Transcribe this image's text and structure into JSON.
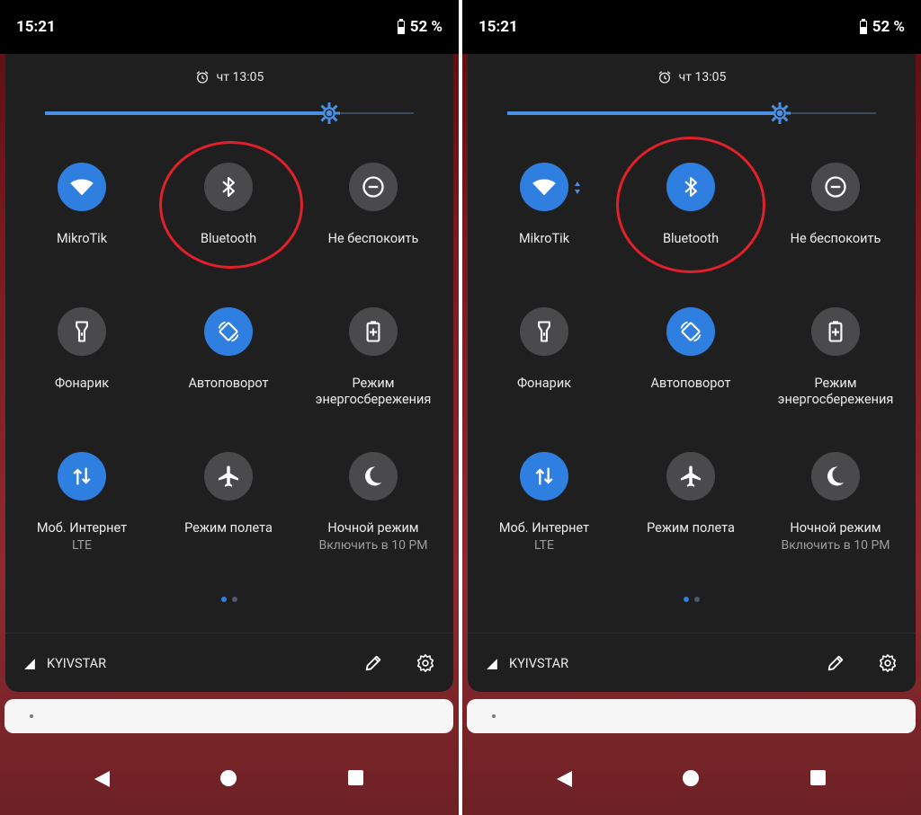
{
  "screens": [
    {
      "status": {
        "time": "15:21",
        "battery": "52 %"
      },
      "alarm": {
        "text": "чт 13:05"
      },
      "brightness": {
        "level": 0.77
      },
      "tiles": [
        {
          "label": "MikroTik",
          "sub": "",
          "state": "on",
          "icon": "wifi-icon"
        },
        {
          "label": "Bluetooth",
          "sub": "",
          "state": "off",
          "icon": "bluetooth-icon"
        },
        {
          "label": "Не беспокоить",
          "sub": "",
          "state": "off",
          "icon": "do-not-disturb-icon"
        },
        {
          "label": "Фонарик",
          "sub": "",
          "state": "off",
          "icon": "flashlight-icon"
        },
        {
          "label": "Автоповорот",
          "sub": "",
          "state": "on",
          "icon": "auto-rotate-icon"
        },
        {
          "label": "Режим энергосбережения",
          "sub": "",
          "state": "off",
          "icon": "battery-saver-icon"
        },
        {
          "label": "Моб. Интернет",
          "sub": "LTE",
          "state": "on",
          "icon": "mobile-data-icon"
        },
        {
          "label": "Режим полета",
          "sub": "",
          "state": "off",
          "icon": "airplane-icon"
        },
        {
          "label": "Ночной режим",
          "sub": "Включить в 10 PM",
          "state": "off",
          "icon": "night-mode-icon"
        }
      ],
      "footer": {
        "carrier": "KYIVSTAR"
      }
    },
    {
      "status": {
        "time": "15:21",
        "battery": "52 %"
      },
      "alarm": {
        "text": "чт 13:05"
      },
      "brightness": {
        "level": 0.74
      },
      "tiles": [
        {
          "label": "MikroTik",
          "sub": "",
          "state": "on",
          "icon": "wifi-icon"
        },
        {
          "label": "Bluetooth",
          "sub": "",
          "state": "on",
          "icon": "bluetooth-icon"
        },
        {
          "label": "Не беспокоить",
          "sub": "",
          "state": "off",
          "icon": "do-not-disturb-icon"
        },
        {
          "label": "Фонарик",
          "sub": "",
          "state": "off",
          "icon": "flashlight-icon"
        },
        {
          "label": "Автоповорот",
          "sub": "",
          "state": "on",
          "icon": "auto-rotate-icon"
        },
        {
          "label": "Режим энергосбережения",
          "sub": "",
          "state": "off",
          "icon": "battery-saver-icon"
        },
        {
          "label": "Моб. Интернет",
          "sub": "LTE",
          "state": "on",
          "icon": "mobile-data-icon"
        },
        {
          "label": "Режим полета",
          "sub": "",
          "state": "off",
          "icon": "airplane-icon"
        },
        {
          "label": "Ночной режим",
          "sub": "Включить в 10 PM",
          "state": "off",
          "icon": "night-mode-icon"
        }
      ],
      "footer": {
        "carrier": "KYIVSTAR"
      }
    }
  ],
  "colors": {
    "accent": "#2f7fe0",
    "tile_off": "#4a4a4c",
    "panel": "#1f1f20",
    "highlight_ring": "#e0202a",
    "dot_active": "#2f7fe0",
    "dot_inactive": "#4a5a70"
  }
}
